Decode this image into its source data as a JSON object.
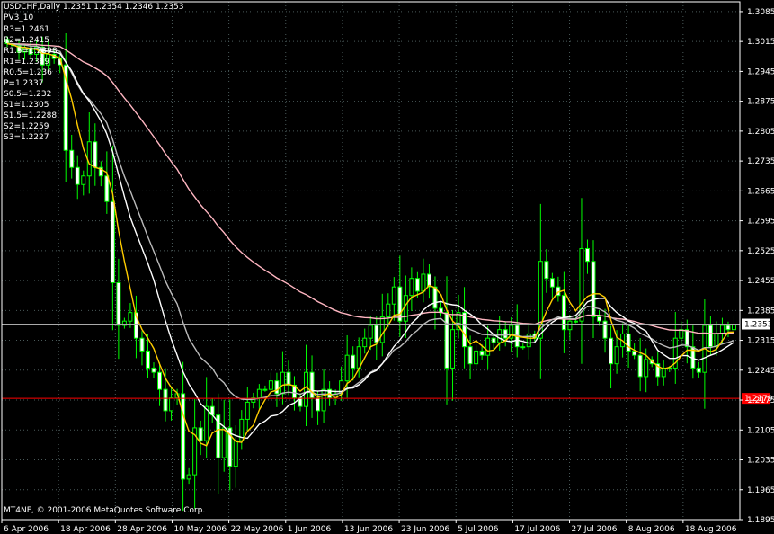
{
  "header": {
    "symbol_line": "USDCHF,Daily  1.2351 1.2354 1.2346 1.2353",
    "indicator_name": "PV3_10"
  },
  "pivot_levels": [
    {
      "label": "R3=1.2461",
      "value": 1.2461
    },
    {
      "label": "R2=1.2415",
      "value": 1.2415
    },
    {
      "label": "R1.5=1.2398",
      "value": 1.2398
    },
    {
      "label": "R1=1.2369",
      "value": 1.2369
    },
    {
      "label": "R0.5=1.236",
      "value": 1.236
    },
    {
      "label": "P=1.2337",
      "value": 1.2337
    },
    {
      "label": "S0.5=1.232",
      "value": 1.232
    },
    {
      "label": "S1=1.2305",
      "value": 1.2305
    },
    {
      "label": "S1.5=1.2288",
      "value": 1.2288
    },
    {
      "label": "S2=1.2259",
      "value": 1.2259
    },
    {
      "label": "S3=1.2227",
      "value": 1.2227
    }
  ],
  "footer": {
    "copyright": "MT4NF, © 2001-2006 MetaQuotes Software Corp."
  },
  "colors": {
    "background": "#000000",
    "grid": "#4a5a5a",
    "axis_text": "#ffffff",
    "candle": "#00ff00",
    "candle_body": "#ffffff",
    "ma_fast": "#ffcc00",
    "ma_white": "#ffffff",
    "ma_gray": "#bbbbbb",
    "ma_pink": "#ffb6c1",
    "support_line": "#ff0000",
    "current_price_line": "#aaaaaa"
  },
  "chart_data": {
    "type": "candlestick",
    "ylim": [
      1.1895,
      1.3108
    ],
    "price_ticks": [
      "1.3085",
      "1.3015",
      "1.2945",
      "1.2875",
      "1.2805",
      "1.2735",
      "1.2665",
      "1.2595",
      "1.2525",
      "1.2455",
      "1.2385",
      "1.2315",
      "1.2245",
      "1.2175",
      "1.2105",
      "1.2035",
      "1.1965",
      "1.1895"
    ],
    "date_ticks": [
      "6 Apr 2006",
      "18 Apr 2006",
      "28 Apr 2006",
      "10 May 2006",
      "22 May 2006",
      "1 Jun 2006",
      "13 Jun 2006",
      "23 Jun 2006",
      "5 Jul 2006",
      "17 Jul 2006",
      "27 Jul 2006",
      "8 Aug 2006",
      "18 Aug 2006"
    ],
    "current_price": {
      "label": "1.2353",
      "value": 1.2353
    },
    "support_level": {
      "label": "1.2179",
      "value": 1.2179
    },
    "close": [
      1.301,
      1.3005,
      1.299,
      1.3,
      1.2985,
      1.3002,
      1.296,
      1.2985,
      1.2975,
      1.296,
      1.276,
      1.272,
      1.268,
      1.27,
      1.278,
      1.272,
      1.27,
      1.264,
      1.245,
      1.235,
      1.236,
      1.238,
      1.232,
      1.229,
      1.225,
      1.224,
      1.22,
      1.215,
      1.218,
      1.219,
      1.199,
      1.2,
      1.211,
      1.208,
      1.216,
      1.214,
      1.204,
      1.211,
      1.202,
      1.208,
      1.213,
      1.217,
      1.218,
      1.22,
      1.22,
      1.222,
      1.219,
      1.224,
      1.221,
      1.218,
      1.216,
      1.224,
      1.218,
      1.215,
      1.22,
      1.218,
      1.219,
      1.222,
      1.228,
      1.225,
      1.23,
      1.232,
      1.235,
      1.231,
      1.237,
      1.24,
      1.244,
      1.236,
      1.242,
      1.246,
      1.243,
      1.247,
      1.244,
      1.239,
      1.238,
      1.225,
      1.234,
      1.238,
      1.23,
      1.226,
      1.229,
      1.228,
      1.232,
      1.231,
      1.234,
      1.232,
      1.235,
      1.23,
      1.23,
      1.233,
      1.232,
      1.25,
      1.246,
      1.244,
      1.242,
      1.234,
      1.236,
      1.236,
      1.253,
      1.25,
      1.237,
      1.236,
      1.232,
      1.226,
      1.23,
      1.233,
      1.229,
      1.228,
      1.223,
      1.227,
      1.226,
      1.223,
      1.225,
      1.225,
      1.232,
      1.234,
      1.23,
      1.225,
      1.224,
      1.235,
      1.23,
      1.233,
      1.235,
      1.234,
      1.2353
    ]
  }
}
